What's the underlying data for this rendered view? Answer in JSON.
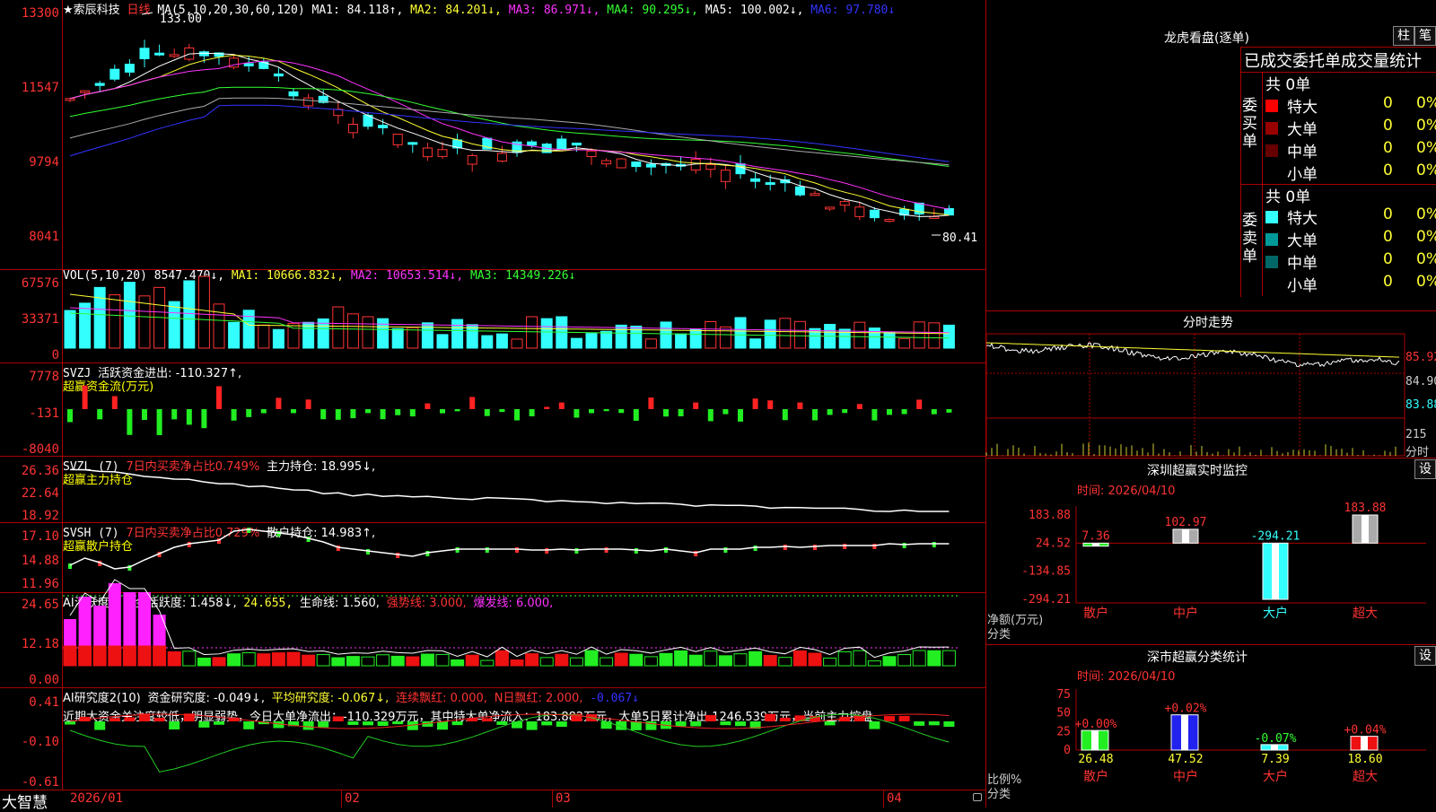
{
  "kline": {
    "header": {
      "title": "★索辰科技",
      "period": "日线",
      "ma_label": "MA(5,10,20,30,60,120)",
      "ma1": "MA1: 84.118↑,",
      "ma2": "MA2: 84.201↓,",
      "ma3": "MA3: 86.971↓,",
      "ma4": "MA4: 90.295↓,",
      "ma5": "MA5: 100.002↓,",
      "ma6": "MA6: 97.780↓"
    },
    "y_ticks": [
      "13300",
      "11547",
      "9794",
      "8041"
    ],
    "high_label": "133.00",
    "low_label": "80.41"
  },
  "vol": {
    "header": {
      "label": "VOL(5,10,20)",
      "value": "8547.470↓,",
      "ma1": "MA1: 10666.832↓,",
      "ma2": "MA2: 10653.514↓,",
      "ma3": "MA3: 14349.226↓"
    },
    "y_ticks": [
      "67576",
      "33371",
      "0"
    ]
  },
  "svzj": {
    "header": {
      "label": "SVZJ",
      "text": "活跃资金进出: -110.327↑,",
      "sub": "超赢资金流(万元)"
    },
    "y_ticks": [
      "7778",
      "-131",
      "-8040"
    ]
  },
  "svzl": {
    "header": {
      "label": "SVZL (7)",
      "net": "7日内买卖净占比0.749%",
      "hold": "主力持仓: 18.995↓,",
      "sub": "超赢主力持仓"
    },
    "y_ticks": [
      "26.36",
      "22.64",
      "18.92"
    ]
  },
  "svsh": {
    "header": {
      "label": "SVSH (7)",
      "net": "7日内买卖净占比0.729%",
      "hold": "散户持仓: 14.983↑,",
      "sub": "超赢散户持仓"
    },
    "y_ticks": [
      "17.10",
      "14.88",
      "11.96"
    ]
  },
  "ai_act": {
    "header": {
      "label": "AI活跃度2",
      "a": "资金活跃度: 1.458↓,",
      "b": "24.655,",
      "c": "生命线: 1.560,",
      "d": "强势线: 3.000,",
      "e": "爆发线: 6.000,"
    },
    "y_ticks": [
      "24.65",
      "12.18",
      "0.00"
    ]
  },
  "ai_res": {
    "header": {
      "label": "AI研究度2(10)",
      "a": "资金研究度: -0.049↓,",
      "b": "平均研究度: -0.067↓,",
      "c": "连续飘红: 0.000,",
      "d": "N日飘红: 2.000,",
      "e": "-0.067↓"
    },
    "comment": "近期大资金关注度较低，明显弱势，今日大单净流出：-110.329万元，其中特大单净流入：183.882万元，大单5日累计净出-1246.539万元，当前主力控盘",
    "y_ticks": [
      "0.41",
      "-0.10",
      "-0.61"
    ]
  },
  "footer": {
    "brand": "大智慧",
    "months": [
      "2026/01",
      "02",
      "03",
      "04"
    ]
  },
  "right": {
    "longhu": {
      "title": "龙虎看盘(逐单)",
      "btn_bar": "柱",
      "btn_pen": "笔",
      "sub_title": "已成交委托单成交量统计",
      "buy_label": "委买单",
      "sell_label": "委卖单",
      "buy_total": "共 0单",
      "sell_total": "共 0单",
      "buy_rows": [
        {
          "name": "特大",
          "count": "0",
          "pct": "0%",
          "color": "#ff0000"
        },
        {
          "name": "大单",
          "count": "0",
          "pct": "0%",
          "color": "#990000"
        },
        {
          "name": "中单",
          "count": "0",
          "pct": "0%",
          "color": "#660000"
        },
        {
          "name": "小单",
          "count": "0",
          "pct": "0%",
          "color": "#000000"
        }
      ],
      "sell_rows": [
        {
          "name": "特大",
          "count": "0",
          "pct": "0%",
          "color": "#33ffff"
        },
        {
          "name": "大单",
          "count": "0",
          "pct": "0%",
          "color": "#009999"
        },
        {
          "name": "中单",
          "count": "0",
          "pct": "0%",
          "color": "#006666"
        },
        {
          "name": "小单",
          "count": "0",
          "pct": "0%",
          "color": "#000000"
        }
      ]
    },
    "intraday": {
      "title": "分时走势",
      "prices": [
        "85.92",
        "84.90",
        "83.88"
      ],
      "vol_max": "215",
      "vol_label": "分时"
    },
    "sz_monitor": {
      "title": "深圳超赢实时监控",
      "btn": "设",
      "time": "时间: 2026/04/10",
      "y_ticks": [
        "183.88",
        "24.52",
        "-134.85",
        "-294.21"
      ],
      "ylabel": "净额(万元)",
      "xlabel": "分类",
      "categories": [
        "散户",
        "中户",
        "大户",
        "超大"
      ],
      "values": [
        "7.36",
        "102.97",
        "-294.21",
        "183.88"
      ]
    },
    "sz_class": {
      "title": "深市超赢分类统计",
      "btn": "设",
      "time": "时间: 2026/04/10",
      "y_ticks": [
        "75",
        "50",
        "25",
        "0"
      ],
      "ylabel": "比例%",
      "xlabel": "分类",
      "categories": [
        "散户",
        "中户",
        "大户",
        "超大"
      ],
      "values": [
        "26.48",
        "47.52",
        "7.39",
        "18.60"
      ],
      "changes": [
        "+0.00%",
        "+0.02%",
        "-0.07%",
        "+0.04%"
      ]
    }
  },
  "chart_data": [
    {
      "type": "bar",
      "title": "深圳超赢实时监控",
      "ylabel": "净额(万元)",
      "xlabel": "分类",
      "categories": [
        "散户",
        "中户",
        "大户",
        "超大"
      ],
      "values": [
        7.36,
        102.97,
        -294.21,
        183.88
      ],
      "ylim": [
        -294.21,
        183.88
      ]
    },
    {
      "type": "bar",
      "title": "深市超赢分类统计",
      "ylabel": "比例%",
      "xlabel": "分类",
      "categories": [
        "散户",
        "中户",
        "大户",
        "超大"
      ],
      "values": [
        26.48,
        47.52,
        7.39,
        18.6
      ],
      "ylim": [
        0,
        75
      ]
    }
  ]
}
